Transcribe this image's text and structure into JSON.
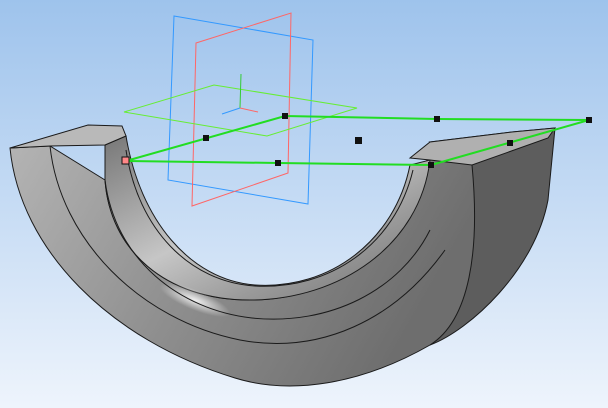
{
  "viewport": {
    "background": {
      "top": "#9ec3ec",
      "bottom": "#eef4fc"
    }
  },
  "colors": {
    "plane_front": "#3399ff",
    "plane_right": "#ff6666",
    "plane_top": "#66ee33",
    "sketch_line": "#22dd22",
    "control_point": "#111111",
    "model_face": "#8c8c8c",
    "model_edge": "#1a1a1a"
  },
  "icons": [
    "origin-axis-icon"
  ],
  "model": {
    "type": "half-ring solid",
    "selected_sketch": "closed polyline"
  }
}
